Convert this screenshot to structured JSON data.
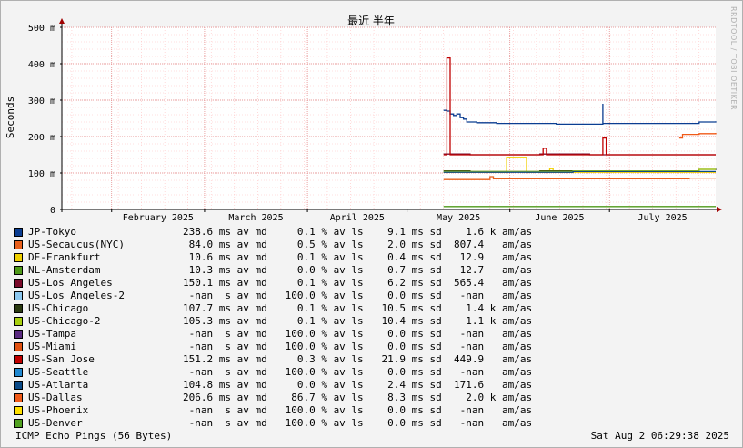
{
  "watermark": "RRDTOOL / TOBI OETIKER",
  "footer": {
    "left": "ICMP Echo Pings (56 Bytes)",
    "right": "Sat Aug  2 06:29:38 2025"
  },
  "chart_data": {
    "type": "line",
    "title": "最近 半年",
    "ylabel": "Seconds",
    "xlabel": "",
    "y_tick_labels": [
      "0",
      "100 m",
      "200 m",
      "300 m",
      "400 m",
      "500 m"
    ],
    "ylim": [
      0,
      0.5
    ],
    "x_range": [
      "2025-01-17",
      "2025-08-02"
    ],
    "x_ticks": [
      {
        "label": "February 2025",
        "date": "2025-02-01"
      },
      {
        "label": "March 2025",
        "date": "2025-03-01"
      },
      {
        "label": "April 2025",
        "date": "2025-04-01"
      },
      {
        "label": "May 2025",
        "date": "2025-05-01"
      },
      {
        "label": "June 2025",
        "date": "2025-06-01"
      },
      {
        "label": "July 2025",
        "date": "2025-07-01"
      }
    ],
    "grid": true,
    "series": [
      {
        "name": "JP-Tokyo",
        "color": "#0b3d91",
        "stats": "238.6 ms av md     0.1 % av ls    9.1 ms sd    1.6 k am/as",
        "points": [
          [
            "2025-05-12",
            0.272
          ],
          [
            "2025-05-13",
            0.27
          ],
          [
            "2025-05-14",
            0.262
          ],
          [
            "2025-05-15",
            0.258
          ],
          [
            "2025-05-16",
            0.262
          ],
          [
            "2025-05-17",
            0.252
          ],
          [
            "2025-05-18",
            0.248
          ],
          [
            "2025-05-19",
            0.24
          ],
          [
            "2025-05-22",
            0.238
          ],
          [
            "2025-05-28",
            0.236
          ],
          [
            "2025-06-05",
            0.236
          ],
          [
            "2025-06-15",
            0.234
          ],
          [
            "2025-06-25",
            0.234
          ],
          [
            "2025-06-28",
            0.234
          ],
          [
            "2025-06-29",
            0.29
          ],
          [
            "2025-06-29",
            0.236
          ],
          [
            "2025-07-05",
            0.236
          ],
          [
            "2025-07-15",
            0.236
          ],
          [
            "2025-07-25",
            0.236
          ],
          [
            "2025-07-28",
            0.24
          ],
          [
            "2025-08-02",
            0.242
          ]
        ]
      },
      {
        "name": "US-Secaucus(NYC)",
        "color": "#e8601c",
        "stats": " 84.0 ms av md     0.5 % av ls    2.0 ms sd  807.4   am/as",
        "points": [
          [
            "2025-05-12",
            0.082
          ],
          [
            "2025-05-25",
            0.082
          ],
          [
            "2025-05-26",
            0.09
          ],
          [
            "2025-05-27",
            0.084
          ],
          [
            "2025-06-15",
            0.084
          ],
          [
            "2025-07-10",
            0.084
          ],
          [
            "2025-07-25",
            0.086
          ],
          [
            "2025-08-02",
            0.086
          ]
        ]
      },
      {
        "name": "DE-Frankfurt",
        "color": "#f0d000",
        "stats": " 10.6 ms av md     0.1 % av ls    0.4 ms sd   12.9   am/as",
        "points": [
          [
            "2025-05-12",
            0.102
          ],
          [
            "2025-05-30",
            0.102
          ],
          [
            "2025-05-31",
            0.143
          ],
          [
            "2025-06-05",
            0.143
          ],
          [
            "2025-06-06",
            0.102
          ],
          [
            "2025-06-12",
            0.102
          ],
          [
            "2025-06-13",
            0.112
          ],
          [
            "2025-06-14",
            0.102
          ],
          [
            "2025-08-02",
            0.102
          ]
        ]
      },
      {
        "name": "NL-Amsterdam",
        "color": "#4f9a1a",
        "stats": " 10.3 ms av md     0.0 % av ls    0.7 ms sd   12.7   am/as",
        "points": [
          [
            "2025-05-12",
            0.008
          ],
          [
            "2025-08-02",
            0.008
          ]
        ]
      },
      {
        "name": "US-Los Angeles",
        "color": "#7a0a2a",
        "stats": "150.1 ms av md     0.1 % av ls    6.2 ms sd  565.4   am/as",
        "points": [
          [
            "2025-05-12",
            0.152
          ],
          [
            "2025-05-20",
            0.15
          ],
          [
            "2025-06-05",
            0.15
          ],
          [
            "2025-06-10",
            0.152
          ],
          [
            "2025-06-25",
            0.15
          ],
          [
            "2025-07-10",
            0.15
          ],
          [
            "2025-08-02",
            0.15
          ]
        ]
      },
      {
        "name": "US-Los Angeles-2",
        "color": "#8cc8f0",
        "stats": " -nan  s av md   100.0 % av ls    0.0 ms sd   -nan   am/as",
        "points": []
      },
      {
        "name": "US-Chicago",
        "color": "#2a3a10",
        "stats": "107.7 ms av md     0.1 % av ls   10.5 ms sd    1.4 k am/as",
        "points": [
          [
            "2025-05-12",
            0.106
          ],
          [
            "2025-05-20",
            0.104
          ],
          [
            "2025-06-10",
            0.106
          ],
          [
            "2025-06-25",
            0.104
          ],
          [
            "2025-07-10",
            0.106
          ],
          [
            "2025-07-28",
            0.11
          ],
          [
            "2025-08-02",
            0.108
          ]
        ]
      },
      {
        "name": "US-Chicago-2",
        "color": "#a8d010",
        "stats": "105.3 ms av md     0.1 % av ls   10.4 ms sd    1.1 k am/as",
        "points": [
          [
            "2025-05-12",
            0.104
          ],
          [
            "2025-06-05",
            0.104
          ],
          [
            "2025-06-20",
            0.106
          ],
          [
            "2025-07-15",
            0.106
          ],
          [
            "2025-07-28",
            0.11
          ],
          [
            "2025-08-02",
            0.11
          ]
        ]
      },
      {
        "name": "US-Tampa",
        "color": "#5a2a80",
        "stats": " -nan  s av md   100.0 % av ls    0.0 ms sd   -nan   am/as",
        "points": []
      },
      {
        "name": "US-Miami",
        "color": "#e05010",
        "stats": " -nan  s av md   100.0 % av ls    0.0 ms sd   -nan   am/as",
        "points": []
      },
      {
        "name": "US-San Jose",
        "color": "#c00000",
        "stats": "151.2 ms av md     0.3 % av ls   21.9 ms sd  449.9   am/as",
        "points": [
          [
            "2025-05-12",
            0.15
          ],
          [
            "2025-05-13",
            0.15
          ],
          [
            "2025-05-13",
            0.416
          ],
          [
            "2025-05-14",
            0.15
          ],
          [
            "2025-06-10",
            0.15
          ],
          [
            "2025-06-11",
            0.168
          ],
          [
            "2025-06-12",
            0.15
          ],
          [
            "2025-06-28",
            0.15
          ],
          [
            "2025-06-29",
            0.196
          ],
          [
            "2025-06-30",
            0.15
          ],
          [
            "2025-08-02",
            0.15
          ]
        ]
      },
      {
        "name": "US-Seattle",
        "color": "#2088d0",
        "stats": " -nan  s av md   100.0 % av ls    0.0 ms sd   -nan   am/as",
        "points": []
      },
      {
        "name": "US-Atlanta",
        "color": "#0a4a88",
        "stats": "104.8 ms av md     0.0 % av ls    2.4 ms sd  171.6   am/as",
        "points": [
          [
            "2025-05-12",
            0.102
          ],
          [
            "2025-06-01",
            0.102
          ],
          [
            "2025-06-20",
            0.104
          ],
          [
            "2025-07-20",
            0.104
          ],
          [
            "2025-08-02",
            0.104
          ]
        ]
      },
      {
        "name": "US-Dallas",
        "color": "#f05a18",
        "stats": "206.6 ms av md    86.7 % av ls    8.3 ms sd    2.0 k am/as",
        "points": [
          [
            "2025-07-22",
            0.196
          ],
          [
            "2025-07-23",
            0.206
          ],
          [
            "2025-07-28",
            0.208
          ],
          [
            "2025-08-02",
            0.21
          ]
        ]
      },
      {
        "name": "US-Phoenix",
        "color": "#ffe000",
        "stats": " -nan  s av md   100.0 % av ls    0.0 ms sd   -nan   am/as",
        "points": []
      },
      {
        "name": "US-Denver",
        "color": "#50a020",
        "stats": " -nan  s av md   100.0 % av ls    0.0 ms sd   -nan   am/as",
        "points": []
      }
    ]
  }
}
